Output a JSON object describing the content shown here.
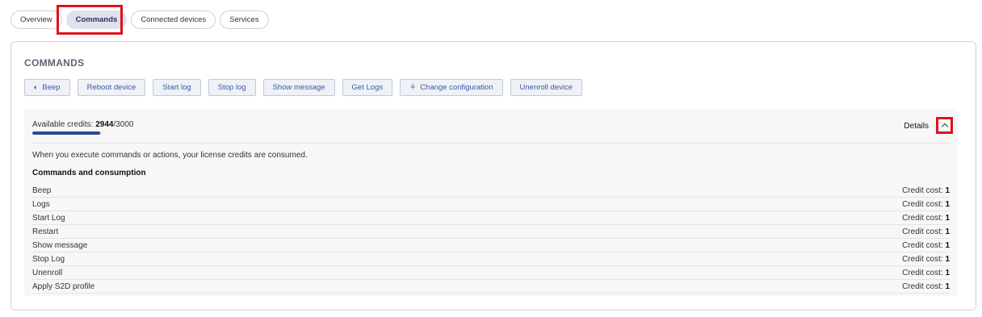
{
  "tabs": [
    {
      "label": "Overview",
      "active": false
    },
    {
      "label": "Commands",
      "active": true
    },
    {
      "label": "Connected devices",
      "active": false
    },
    {
      "label": "Services",
      "active": false
    }
  ],
  "panel": {
    "title": "COMMANDS",
    "buttons": [
      {
        "label": "Beep",
        "icon": "speaker-icon"
      },
      {
        "label": "Reboot device"
      },
      {
        "label": "Start log"
      },
      {
        "label": "Stop log"
      },
      {
        "label": "Show message"
      },
      {
        "label": "Get Logs"
      },
      {
        "label": "Change configuration",
        "icon": "settings-icon"
      },
      {
        "label": "Unenroll device"
      }
    ]
  },
  "credits": {
    "label": "Available credits:",
    "used": "2944",
    "total": "/3000",
    "progress_fraction": 0.9813,
    "details_label": "Details",
    "info_text": "When you execute commands or actions, your license credits are consumed.",
    "section_title": "Commands and consumption",
    "cost_label": "Credit cost:",
    "rows": [
      {
        "name": "Beep",
        "cost": "1"
      },
      {
        "name": "Logs",
        "cost": "1"
      },
      {
        "name": "Start Log",
        "cost": "1"
      },
      {
        "name": "Restart",
        "cost": "1"
      },
      {
        "name": "Show message",
        "cost": "1"
      },
      {
        "name": "Stop Log",
        "cost": "1"
      },
      {
        "name": "Unenroll",
        "cost": "1"
      },
      {
        "name": "Apply S2D profile",
        "cost": "1"
      }
    ]
  },
  "colors": {
    "accent": "#2e4a93",
    "highlight": "#e0121b",
    "button_text": "#3b5aa8"
  }
}
